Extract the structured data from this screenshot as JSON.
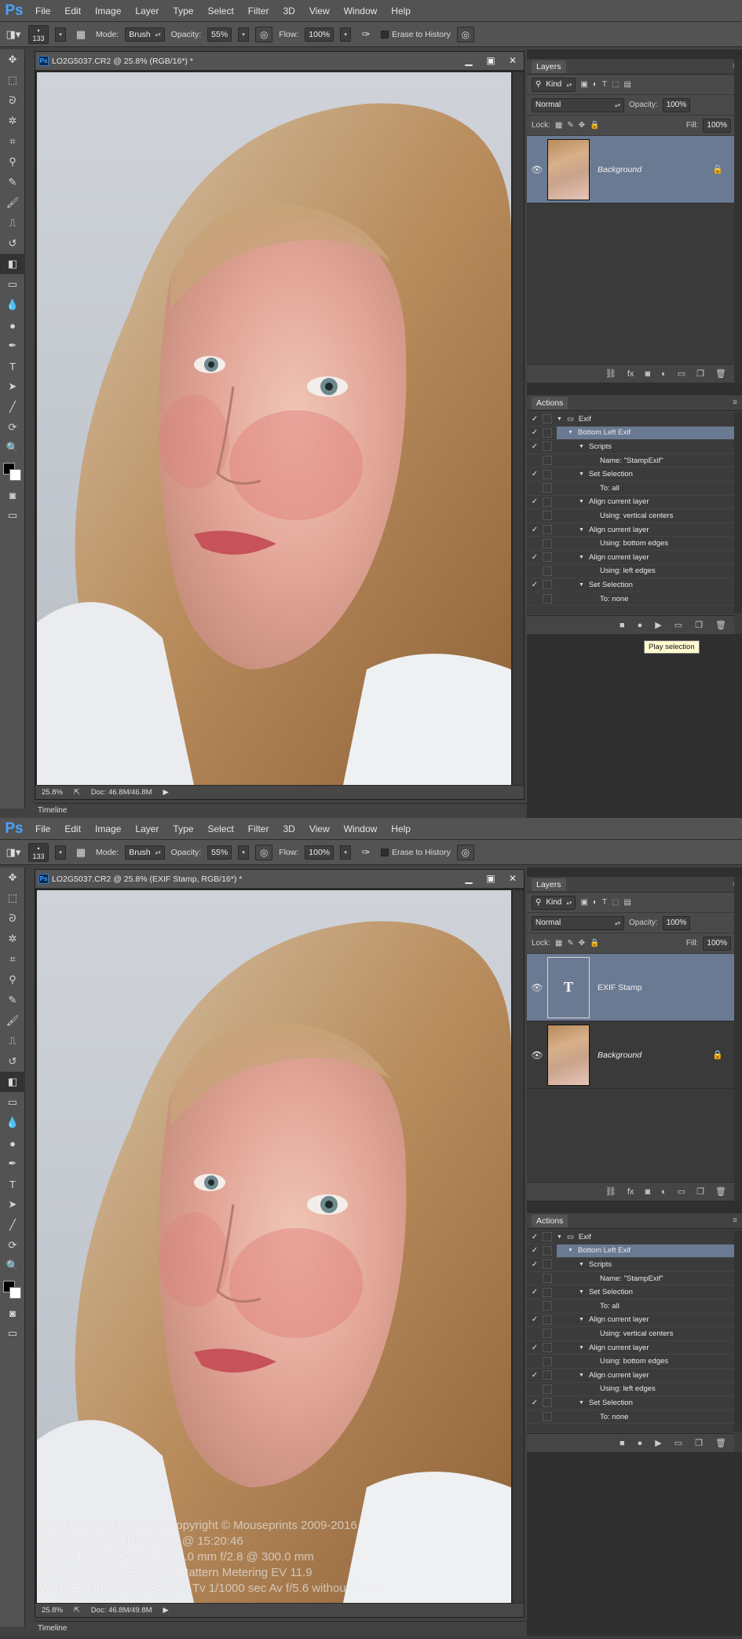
{
  "menu": [
    "File",
    "Edit",
    "Image",
    "Layer",
    "Type",
    "Select",
    "Filter",
    "3D",
    "View",
    "Window",
    "Help"
  ],
  "ps_logo": "Ps",
  "options": {
    "brush_size": "133",
    "mode_label": "Mode:",
    "mode_value": "Brush",
    "opacity_label": "Opacity:",
    "opacity_value": "55%",
    "flow_label": "Flow:",
    "flow_value": "100%",
    "erase_history": "Erase to History"
  },
  "screens": [
    {
      "doc_title": "LO2G5037.CR2 @ 25.8% (RGB/16*) *",
      "zoom": "25.8%",
      "doc_info": "Doc: 46.8M/46.8M",
      "timeline": "Timeline",
      "layers": {
        "tab": "Layers",
        "kind": "Kind",
        "blend": "Normal",
        "opacity_label": "Opacity:",
        "opacity_value": "100%",
        "lock_label": "Lock:",
        "fill_label": "Fill:",
        "fill_value": "100%",
        "items": [
          {
            "name": "Background",
            "selected": true,
            "locked": true,
            "type": "image"
          }
        ]
      },
      "actions": {
        "tab": "Actions",
        "rows": [
          {
            "label": "Exif",
            "level": 0,
            "tri": true,
            "folder": true,
            "check": true
          },
          {
            "label": "Bottom Left Exif",
            "level": 1,
            "tri": true,
            "check": true,
            "selected": true
          },
          {
            "label": "Scripts",
            "level": 2,
            "tri": true,
            "check": true
          },
          {
            "label": "Name: \"StampExif\"",
            "level": 3,
            "tri": false,
            "check": false
          },
          {
            "label": "Set Selection",
            "level": 2,
            "tri": true,
            "check": true
          },
          {
            "label": "To: all",
            "level": 3,
            "tri": false,
            "check": false
          },
          {
            "label": "Align current layer",
            "level": 2,
            "tri": true,
            "check": true
          },
          {
            "label": "Using: vertical centers",
            "level": 3,
            "tri": false,
            "check": false
          },
          {
            "label": "Align current layer",
            "level": 2,
            "tri": true,
            "check": true
          },
          {
            "label": "Using: bottom edges",
            "level": 3,
            "tri": false,
            "check": false
          },
          {
            "label": "Align current layer",
            "level": 2,
            "tri": true,
            "check": true
          },
          {
            "label": "Using: left edges",
            "level": 3,
            "tri": false,
            "check": false
          },
          {
            "label": "Set Selection",
            "level": 2,
            "tri": true,
            "check": true
          },
          {
            "label": "To: none",
            "level": 3,
            "tri": false,
            "check": false
          }
        ]
      },
      "tooltip": "Play selection"
    },
    {
      "doc_title": "LO2G5037.CR2 @ 25.8% (EXIF Stamp, RGB/16*) *",
      "zoom": "25.8%",
      "doc_info": "Doc: 46.8M/49.8M",
      "timeline": "Timeline",
      "layers": {
        "tab": "Layers",
        "kind": "Kind",
        "blend": "Normal",
        "opacity_label": "Opacity:",
        "opacity_value": "100%",
        "lock_label": "Lock:",
        "fill_label": "Fill:",
        "fill_value": "100%",
        "items": [
          {
            "name": "EXIF Stamp",
            "selected": true,
            "locked": false,
            "type": "text"
          },
          {
            "name": "Background",
            "selected": false,
            "locked": true,
            "type": "image"
          }
        ]
      },
      "actions": {
        "tab": "Actions",
        "rows": [
          {
            "label": "Exif",
            "level": 0,
            "tri": true,
            "folder": true,
            "check": true
          },
          {
            "label": "Bottom Left Exif",
            "level": 1,
            "tri": true,
            "check": true,
            "selected": true
          },
          {
            "label": "Scripts",
            "level": 2,
            "tri": true,
            "check": true
          },
          {
            "label": "Name: \"StampExif\"",
            "level": 3,
            "tri": false,
            "check": false
          },
          {
            "label": "Set Selection",
            "level": 2,
            "tri": true,
            "check": true
          },
          {
            "label": "To: all",
            "level": 3,
            "tri": false,
            "check": false
          },
          {
            "label": "Align current layer",
            "level": 2,
            "tri": true,
            "check": true
          },
          {
            "label": "Using: vertical centers",
            "level": 3,
            "tri": false,
            "check": false
          },
          {
            "label": "Align current layer",
            "level": 2,
            "tri": true,
            "check": true
          },
          {
            "label": "Using: bottom edges",
            "level": 3,
            "tri": false,
            "check": false
          },
          {
            "label": "Align current layer",
            "level": 2,
            "tri": true,
            "check": true
          },
          {
            "label": "Using: left edges",
            "level": 3,
            "tri": false,
            "check": false
          },
          {
            "label": "Set Selection",
            "level": 2,
            "tri": true,
            "check": true
          },
          {
            "label": "To: none",
            "level": 3,
            "tri": false,
            "check": false
          }
        ]
      },
      "exif_lines": [
        "Picture  LO2G5037.CR2  Copyright © Mouseprints 2009-2016",
        "by McAssey  April 25, 2009 @ 15:20:46",
        "Canon EOS-1D Mark II  300.0 mm  f/2.8 @ 300.0 mm",
        "Normal program  Bias 0.00  Pattern Metering  EV 11.9",
        "White Balance Auto  ISO 800  Tv 1/1000 sec  Av f/5.6  without Flash"
      ]
    }
  ],
  "tools": [
    "move-tool",
    "marquee-tool",
    "lasso-tool",
    "magic-wand-tool",
    "crop-tool",
    "eyedropper-tool",
    "healing-brush-tool",
    "brush-tool",
    "clone-stamp-tool",
    "history-brush-tool",
    "eraser-tool",
    "gradient-tool",
    "blur-tool",
    "dodge-tool",
    "pen-tool",
    "type-tool",
    "path-selection-tool",
    "line-tool",
    "3d-rotate-tool",
    "zoom-tool"
  ],
  "tool_glyphs": [
    "✥",
    "⬚",
    "ᘐ",
    "✲",
    "⌗",
    "⚲",
    "✎",
    "🖌",
    "⎍",
    "↺",
    "◧",
    "▭",
    "💧",
    "●",
    "✒",
    "T",
    "➤",
    "╱",
    "⟳",
    "🔍"
  ],
  "active_tool_index": 10,
  "colors": {
    "accent": "#6b7a93",
    "ps_blue": "#4aa3ff",
    "tooltip_bg": "#fffad0"
  }
}
